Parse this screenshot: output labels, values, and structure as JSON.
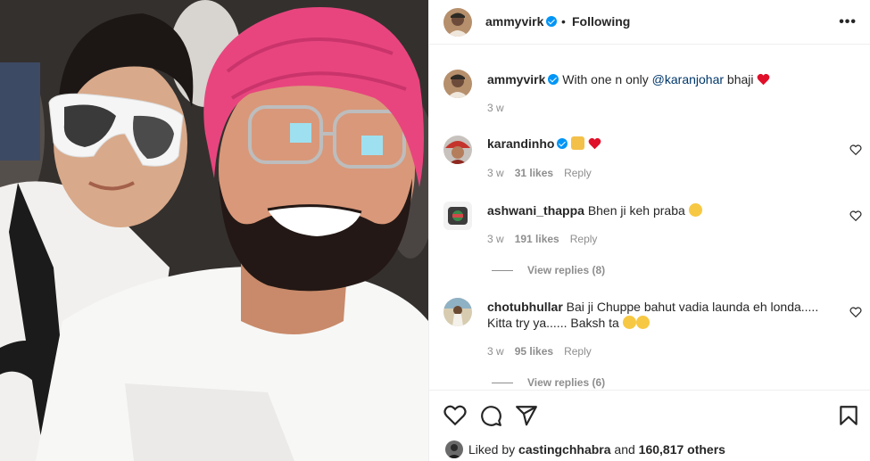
{
  "post": {
    "username": "ammyvirk",
    "header_following": "Following",
    "header_dot": "•",
    "more_icon": "more-horizontal-icon"
  },
  "caption": {
    "username": "ammyvirk",
    "text_before": "With one n only ",
    "mention": "@karanjohar",
    "text_after": " bhaji",
    "time": "3 w"
  },
  "comments": [
    {
      "username": "karandinho",
      "text": "",
      "time": "3 w",
      "likes": "31 likes",
      "reply": "Reply"
    },
    {
      "username": "ashwani_thappa",
      "text": "Bhen ji keh praba",
      "time": "3 w",
      "likes": "191 likes",
      "reply": "Reply",
      "view_replies": "View replies (8)"
    },
    {
      "username": "chotubhullar",
      "text": "Bai ji Chuppe bahut vadia launda eh londa..... Kitta try ya...... Baksh ta",
      "time": "3 w",
      "likes": "95 likes",
      "reply": "Reply",
      "view_replies": "View replies (6)"
    }
  ],
  "actions": {
    "liked_by_prefix": "Liked by ",
    "liked_by_user": "castingchhabra",
    "liked_by_and": " and ",
    "liked_by_count": "160,817 others"
  },
  "colors": {
    "verified": "#0095f6",
    "heart": "#ed4956",
    "turban": "#e8457e"
  }
}
